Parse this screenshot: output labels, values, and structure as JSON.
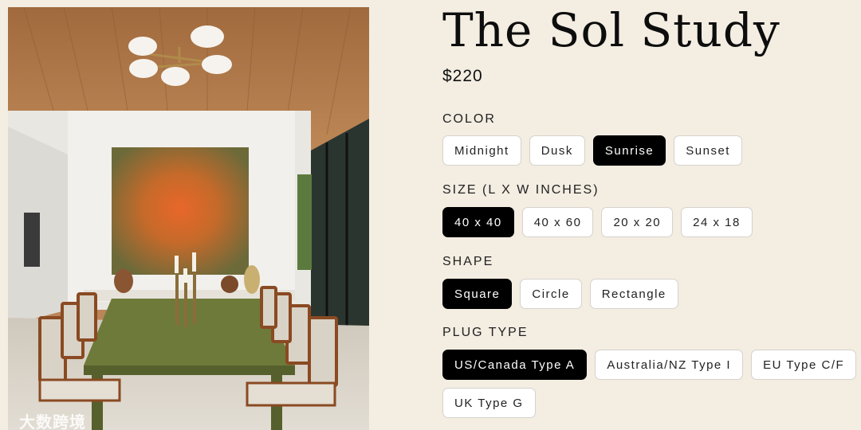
{
  "product": {
    "title": "The Sol Study",
    "price": "$220"
  },
  "watermark": "大数跨境",
  "options": {
    "color": {
      "label": "COLOR",
      "items": [
        "Midnight",
        "Dusk",
        "Sunrise",
        "Sunset"
      ],
      "selected": "Sunrise"
    },
    "size": {
      "label": "SIZE (L X W INCHES)",
      "items": [
        "40 x 40",
        "40 x 60",
        "20 x 20",
        "24 x 18"
      ],
      "selected": "40 x 40"
    },
    "shape": {
      "label": "SHAPE",
      "items": [
        "Square",
        "Circle",
        "Rectangle"
      ],
      "selected": "Square"
    },
    "plug": {
      "label": "PLUG TYPE",
      "items": [
        "US/Canada Type A",
        "Australia/NZ Type I",
        "EU Type C/F",
        "UK Type G"
      ],
      "selected": "US/Canada Type A"
    }
  },
  "colors": {
    "background": "#f3ede2",
    "selected_bg": "#000000",
    "option_bg": "#ffffff"
  }
}
